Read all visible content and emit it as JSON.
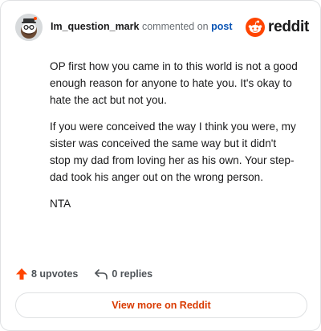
{
  "header": {
    "username": "Im_question_mark",
    "verb": "commented on",
    "target": "post",
    "brand": "reddit"
  },
  "comment": {
    "paragraphs": [
      "OP first how you came in to this world is not a good enough reason for anyone to hate you. It's okay to hate the act but not you.",
      "If you were conceived the way I think you were, my sister was conceived the same way but it didn't stop my dad from loving her as his own. Your step-dad took his anger out on the wrong person.",
      "NTA"
    ]
  },
  "actions": {
    "upvotes": "8 upvotes",
    "replies": "0 replies"
  },
  "view_more": "View more on Reddit",
  "colors": {
    "accent": "#d93a00",
    "upvote": "#ff4500",
    "link": "#0b55b5"
  },
  "icons": {
    "avatar": "snoo-avatar",
    "brand": "reddit-logo-icon",
    "upvote": "upvote-arrow-icon",
    "reply": "reply-arrow-icon"
  }
}
